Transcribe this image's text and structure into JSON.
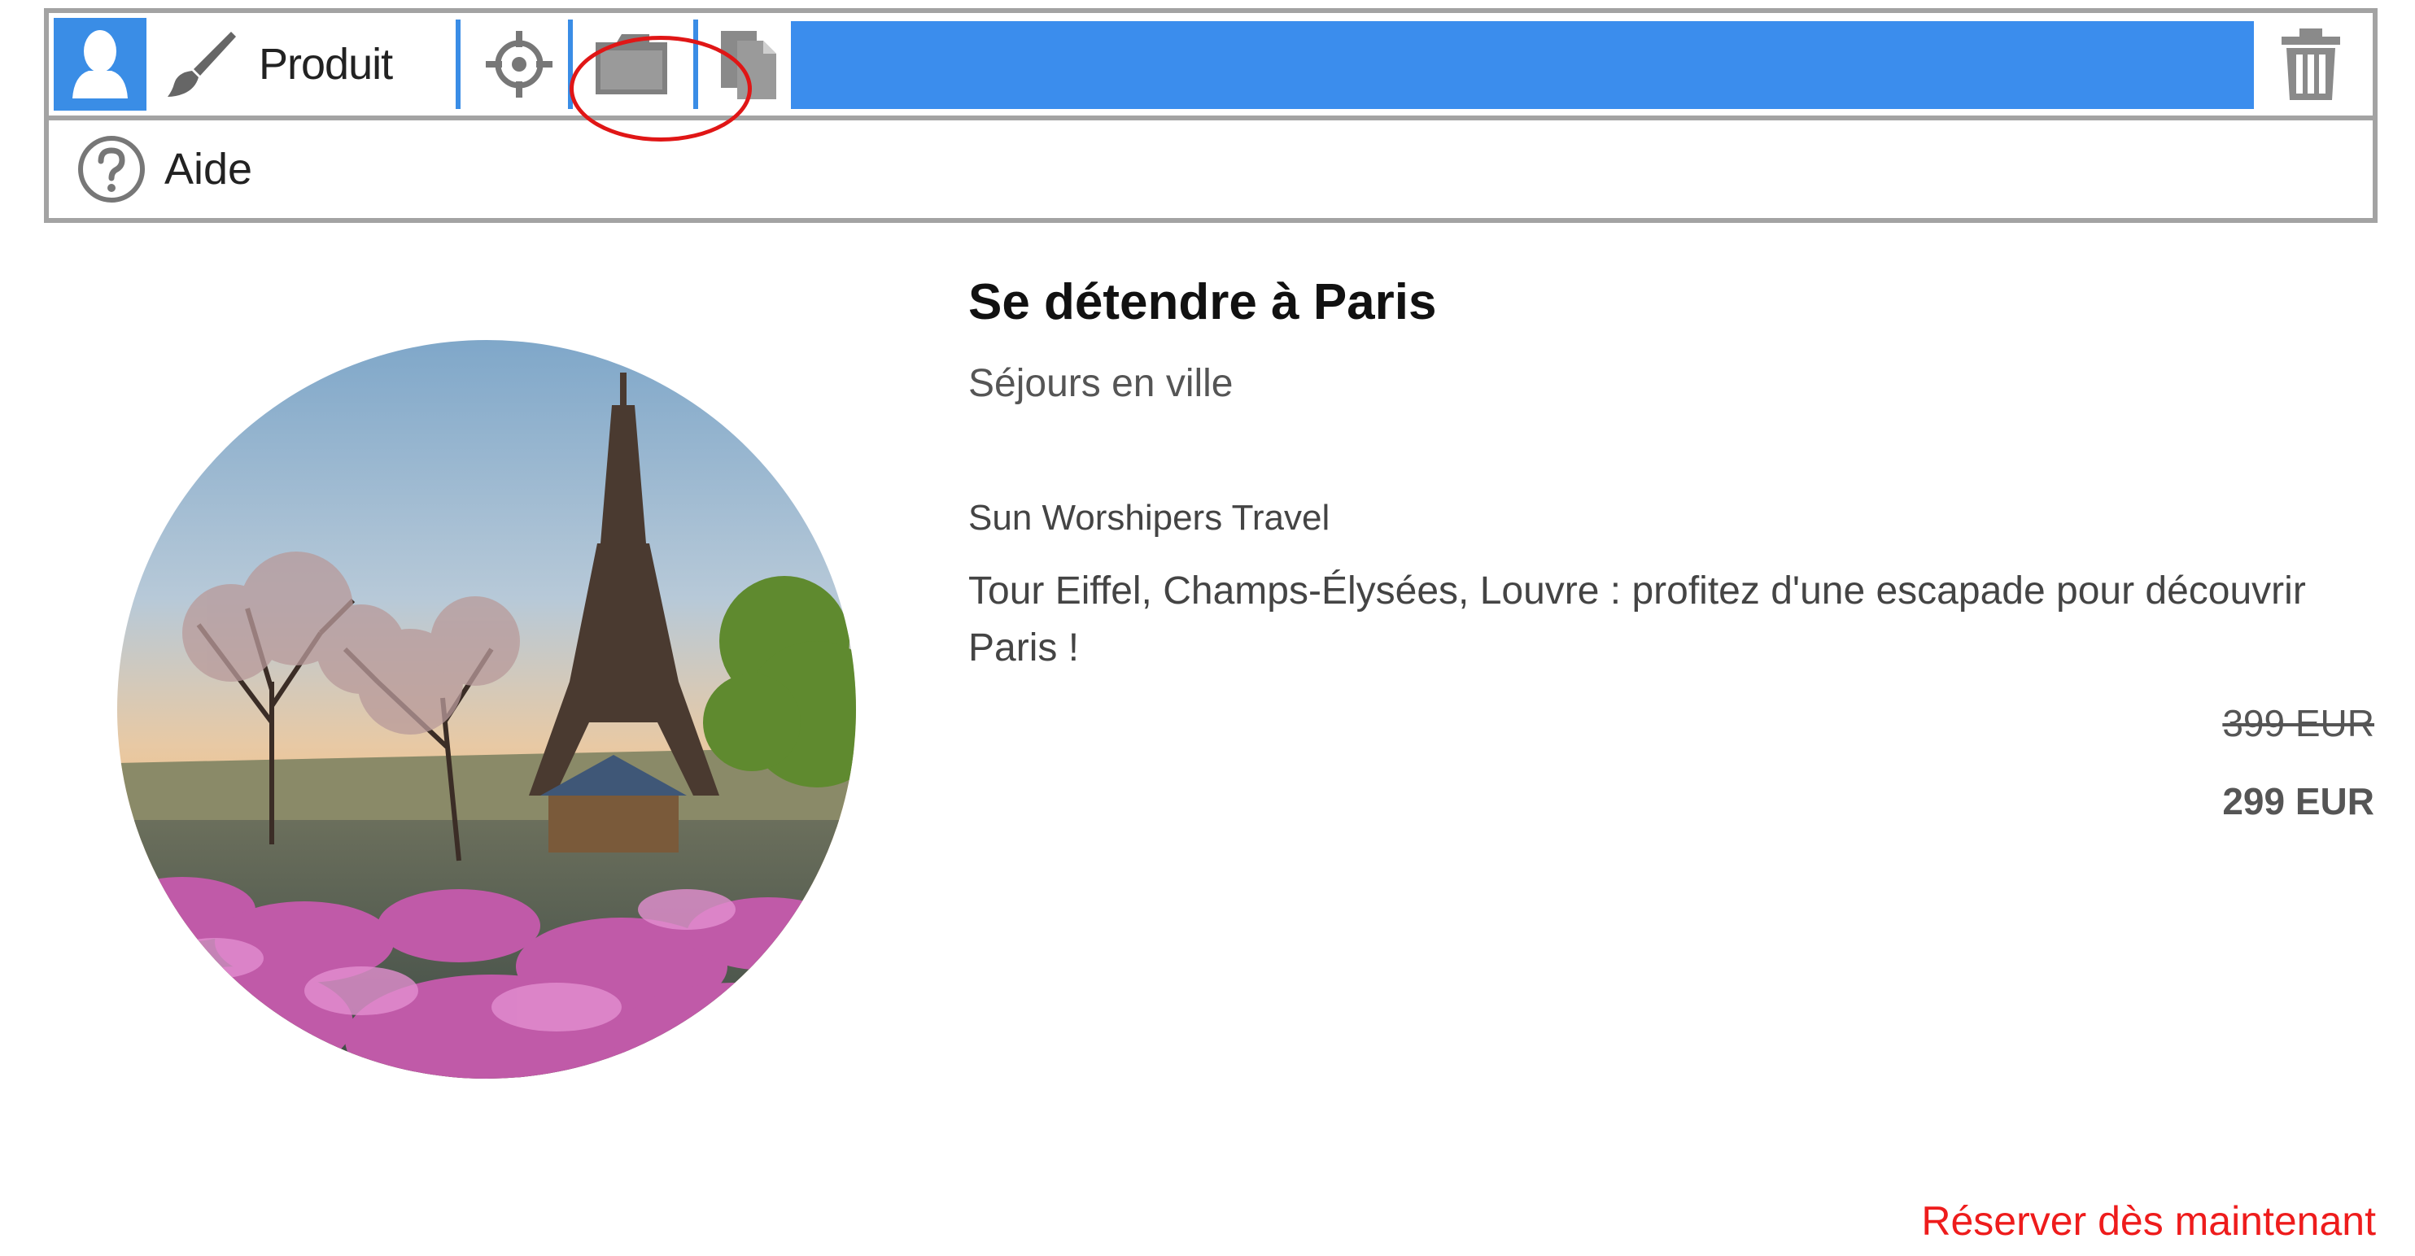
{
  "toolbar": {
    "row1": {
      "person_icon": "person-icon",
      "edit_label": "Produit",
      "edit_icon": "brush-icon",
      "target_icon": "crosshair-icon",
      "folder_icon": "folder-icon",
      "copy_icon": "copy-icon",
      "trash_icon": "trash-icon"
    },
    "row2": {
      "help_icon": "help-icon",
      "help_label": "Aide"
    },
    "accent_color": "#3b8ded",
    "highlight_color": "#e01616"
  },
  "product": {
    "title": "Se détendre à Paris",
    "category": "Séjours en ville",
    "company": "Sun Worshipers Travel",
    "description": "Tour Eiffel, Champs-Élysées, Louvre : profitez d'une escapade pour découvrir Paris !",
    "old_price": "399 EUR",
    "new_price": "299 EUR",
    "cta": "Réserver dès maintenant"
  }
}
